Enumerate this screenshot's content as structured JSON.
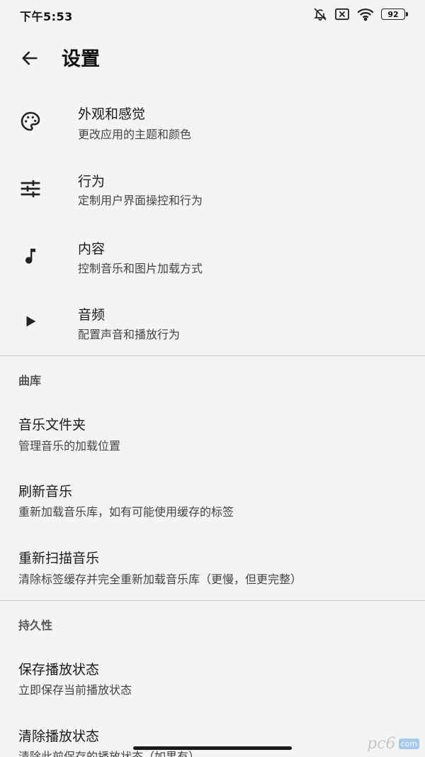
{
  "status_bar": {
    "time": "下午5:53",
    "battery": "92"
  },
  "app_bar": {
    "title": "设置"
  },
  "top_items": [
    {
      "title": "外观和感觉",
      "summary": "更改应用的主题和颜色",
      "icon": "palette-icon"
    },
    {
      "title": "行为",
      "summary": "定制用户界面操控和行为",
      "icon": "tune-icon"
    },
    {
      "title": "内容",
      "summary": "控制音乐和图片加载方式",
      "icon": "music-note-icon"
    },
    {
      "title": "音频",
      "summary": "配置声音和播放行为",
      "icon": "play-icon"
    }
  ],
  "library": {
    "header": "曲库",
    "items": [
      {
        "title": "音乐文件夹",
        "summary": "管理音乐的加载位置"
      },
      {
        "title": "刷新音乐",
        "summary": "重新加载音乐库，如有可能使用缓存的标签"
      },
      {
        "title": "重新扫描音乐",
        "summary": "清除标签缓存并完全重新加载音乐库（更慢，但更完整）"
      }
    ]
  },
  "persistence": {
    "header": "持久性",
    "items": [
      {
        "title": "保存播放状态",
        "summary": "立即保存当前播放状态"
      },
      {
        "title": "清除播放状态",
        "summary": "清除此前保存的播放状态（如果有）"
      }
    ]
  },
  "watermark": {
    "text": "pc6",
    "suffix": "com"
  },
  "colors": {
    "background": "#f4f4f4",
    "text": "#1c1c1c",
    "subtext": "#444444",
    "divider": "#c8c8c8"
  }
}
